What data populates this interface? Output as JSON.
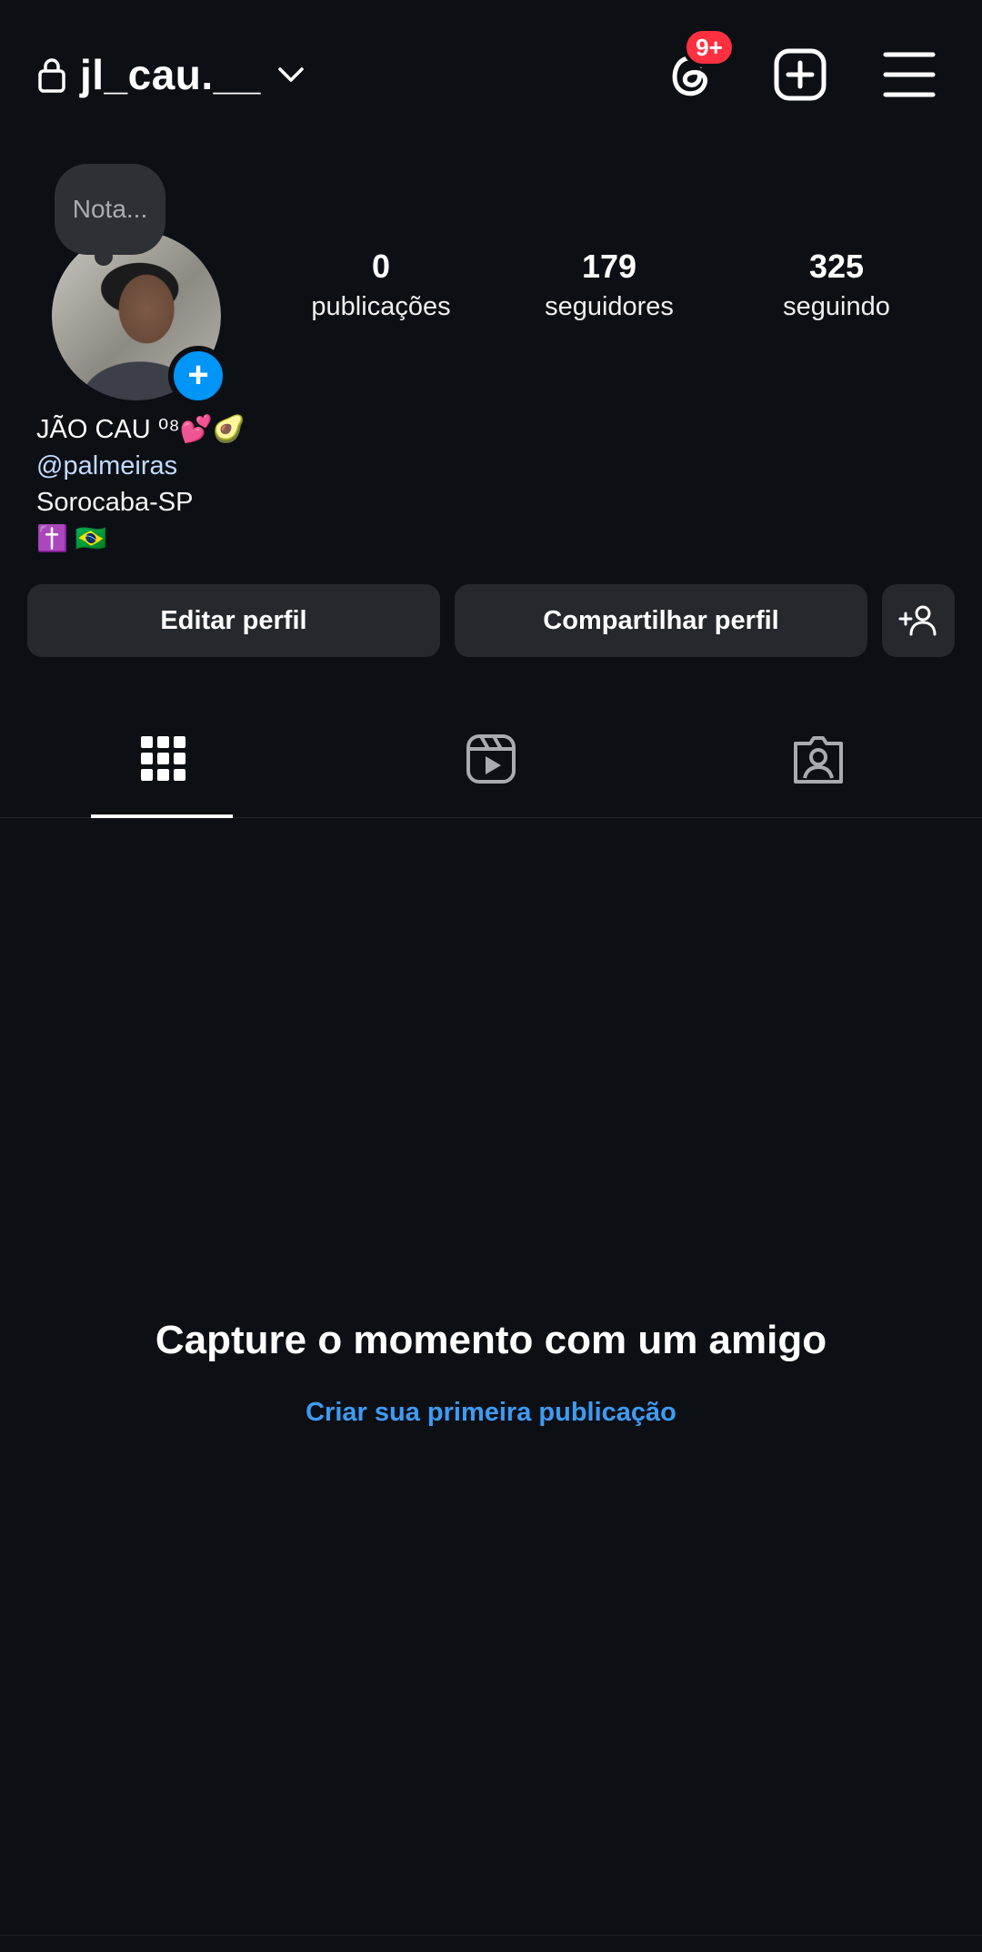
{
  "header": {
    "username": "jl_cau.__",
    "notifications_badge": "9+",
    "icons": {
      "lock": "lock-icon",
      "account_switch": "chevron-down-icon",
      "threads": "threads-icon",
      "create": "create-post-icon",
      "menu": "hamburger-menu-icon"
    },
    "badge_color": "#ff3040"
  },
  "profile": {
    "note_placeholder": "Nota...",
    "avatar_add_label": "+",
    "stats": {
      "posts": {
        "value": "0",
        "label": "publicações"
      },
      "followers": {
        "value": "179",
        "label": "seguidores"
      },
      "following": {
        "value": "325",
        "label": "seguindo"
      }
    },
    "bio": {
      "name": "JÃO CAU ⁰⁸💕🥑",
      "mention": "@palmeiras",
      "location": "Sorocaba-SP",
      "emojis": "✝️ 🇧🇷"
    }
  },
  "actions": {
    "edit_label": "Editar perfil",
    "share_label": "Compartilhar perfil",
    "suggest_icon": "add-person-icon"
  },
  "tabs": [
    {
      "icon": "grid-icon",
      "active": true
    },
    {
      "icon": "reels-icon",
      "active": false
    },
    {
      "icon": "tagged-icon",
      "active": false
    }
  ],
  "empty_state": {
    "title": "Capture o momento com um amigo",
    "link": "Criar sua primeira publicação"
  },
  "colors": {
    "background": "#0c0f14",
    "button_bg": "#25282d",
    "accent_blue": "#0095f6",
    "link_blue": "#3d9bf4",
    "mention_blue": "#c3dbff"
  }
}
